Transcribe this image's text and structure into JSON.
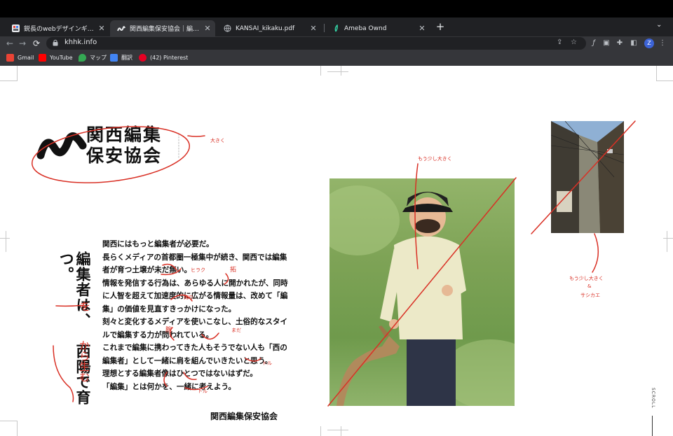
{
  "browser": {
    "tabs": [
      {
        "title": "鋭長のwebデザインギャラリー・サ"
      },
      {
        "title": "関西編集保安協会｜編集者を、西陽"
      },
      {
        "title": "KANSAI_kikaku.pdf"
      },
      {
        "title": "Ameba Ownd"
      }
    ],
    "new_tab": "+",
    "tab_list": "⌄",
    "url": "khhk.info",
    "avatar_letter": "Z",
    "bookmarks": [
      {
        "label": "Gmail",
        "color": "#ea4335"
      },
      {
        "label": "YouTube",
        "color": "#ff0000"
      },
      {
        "label": "マップ",
        "color": "#34a853"
      },
      {
        "label": "翻訳",
        "color": "#4285f4"
      },
      {
        "label": "(42) Pinterest",
        "color": "#e60023"
      }
    ]
  },
  "site": {
    "logo_name_line1": "関西編集",
    "logo_name_line2": "保安協会",
    "vertical_title": {
      "part1": "編集者は、",
      "part2": "西陽で育つ。"
    },
    "body_lines": [
      "関西にはもっと編集者が必要だ。",
      "長らくメディアの首都圏一極集中が続き、関西では編集",
      "者が育つ土壌が未だ無い。",
      "情報を発信する行為は、あらゆる人に開かれたが、同時",
      "に人智を超えて加速度的に広がる情報量は、改めて「編",
      "集」の価値を見直すきっかけになった。",
      "刻々と変化するメディアを使いこなし、土俗的なスタイ",
      "ルで編集する力が問われている。",
      "これまで編集に携わってきた人もそうでない人も「西の",
      "編集者」として一緒に肩を組んでいきたいと思う。",
      "理想とする編集者像はひとつではないはずだ。",
      "「編集」とは何かを、一緒に考えよう。"
    ],
    "organization": "関西編集保安協会",
    "scroll_label": "SCROLL"
  },
  "annotations": {
    "okiku": "大きく",
    "mou_sukoshi_okiku": "もう少し大きく",
    "mou_sukoshi_okiku_and": "もう少し大きく",
    "amp": "&",
    "saishiki": "サシカエ",
    "wo": "を",
    "kara_umu": "から生む",
    "hiraku": "ヒラク",
    "taku": "拓",
    "sukui": "掬り",
    "mada": "まだ",
    "ude": "腕",
    "toru1": "トル",
    "toru2": "トル",
    "color": "#d93025"
  }
}
